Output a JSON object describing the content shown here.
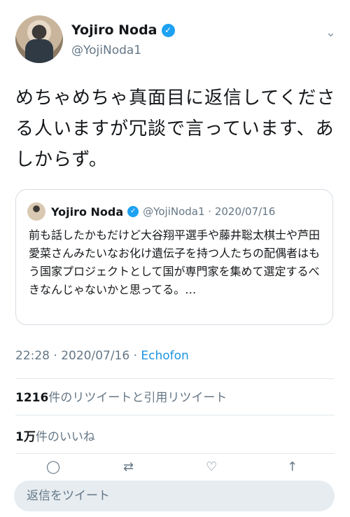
{
  "author": {
    "name": "Yojiro Noda",
    "handle": "@YojiNoda1"
  },
  "tweet": {
    "text": "めちゃめちゃ真面目に返信してくださる人いますが冗談で言っています、あしからず。"
  },
  "quoted": {
    "name": "Yojiro Noda",
    "meta": "@YojiNoda1 · 2020/07/16",
    "text": "前も話したかもだけど大谷翔平選手や藤井聡太棋士や芦田愛菜さんみたいなお化け遺伝子を持つ人たちの配偶者はもう国家プロジェクトとして国が専門家を集めて選定するべきなんじゃないかと思ってる。…"
  },
  "timestamp": {
    "time": "22:28 · 2020/07/16 · ",
    "via": "Echofon"
  },
  "stats": {
    "retweets_count": "1216",
    "retweets_label": "件のリツイートと引用リツイート",
    "likes_count": "1万",
    "likes_label": "件のいいね"
  },
  "reply": {
    "placeholder": "返信をツイート"
  },
  "icons": {
    "verified": "verified-badge-icon",
    "chevron": "chevron-down-icon",
    "reply": "reply-icon",
    "retweet": "retweet-icon",
    "like": "heart-icon",
    "share": "share-icon"
  },
  "colors": {
    "accent": "#1da1f2",
    "link": "#1b95e0",
    "secondary_text": "#657786"
  }
}
